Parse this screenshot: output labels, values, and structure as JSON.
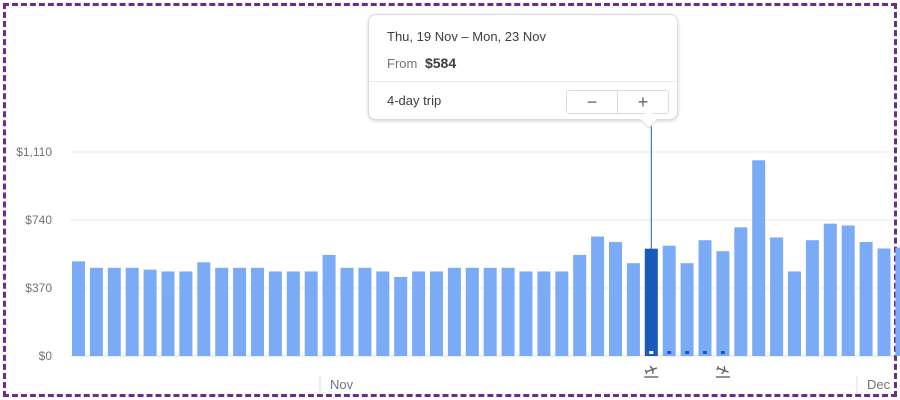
{
  "tooltip": {
    "dates": "Thu, 19 Nov – Mon, 23 Nov",
    "from_label": "From",
    "price": "$584",
    "trip_length": "4-day trip",
    "minus_label": "−",
    "plus_label": "+"
  },
  "colors": {
    "bar": "#7baaf7",
    "bar_selected": "#185abc",
    "grid": "#e8eaed",
    "axis_text": "#70757a",
    "frame": "#6a2c91"
  },
  "chart_data": {
    "type": "bar",
    "ylim": [
      0,
      1110
    ],
    "y_ticks": [
      {
        "value": 0,
        "label": "$0"
      },
      {
        "value": 370,
        "label": "$370"
      },
      {
        "value": 740,
        "label": "$740"
      },
      {
        "value": 1110,
        "label": "$1,110"
      }
    ],
    "x_labels": [
      "Nov",
      "Dec"
    ],
    "selected_index": 32,
    "values": [
      515,
      480,
      480,
      480,
      470,
      460,
      460,
      510,
      480,
      480,
      480,
      460,
      460,
      460,
      550,
      480,
      480,
      460,
      430,
      460,
      460,
      480,
      480,
      480,
      480,
      460,
      460,
      460,
      550,
      650,
      620,
      505,
      584,
      600,
      505,
      630,
      570,
      700,
      1065,
      645,
      460,
      630,
      720,
      710,
      620,
      585,
      590
    ],
    "grid": true,
    "markers": [
      {
        "type": "departure",
        "icon": "takeoff-icon"
      },
      {
        "type": "return",
        "icon": "landing-icon"
      }
    ]
  }
}
